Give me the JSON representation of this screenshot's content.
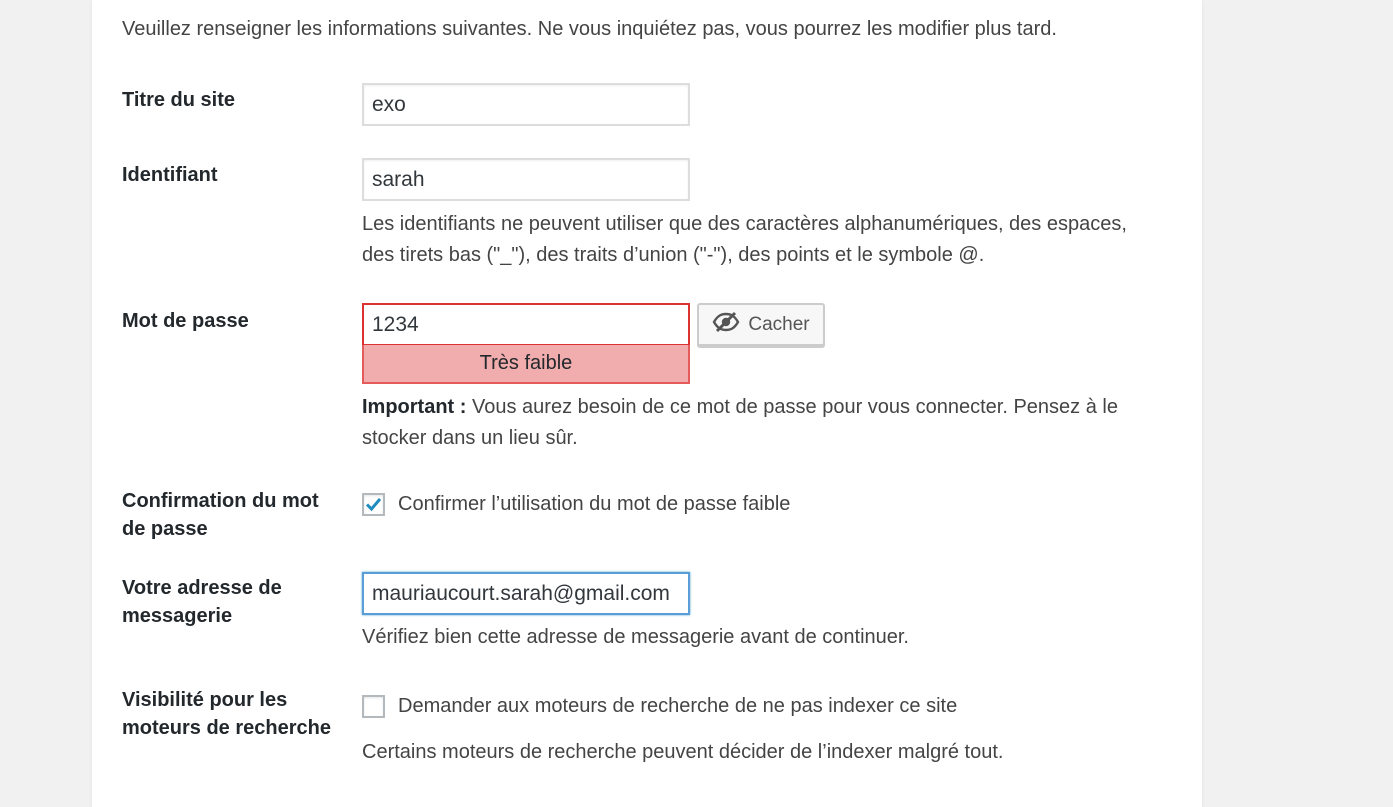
{
  "intro_text": "Veuillez renseigner les informations suivantes. Ne vous inquiétez pas, vous pourrez les modifier plus tard.",
  "site_title": {
    "label": "Titre du site",
    "value": "exo"
  },
  "username": {
    "label": "Identifiant",
    "value": "sarah",
    "help": "Les identifiants ne peuvent utiliser que des caractères alphanumériques, des espaces, des tirets bas (\"_\"), des traits d’union (\"-\"), des points et le symbole @."
  },
  "password": {
    "label": "Mot de passe",
    "value": "1234",
    "strength": "Très faible",
    "toggle_label": "Cacher",
    "toggle_icon": "eye-slash-icon",
    "important_prefix": "Important :",
    "important_text": " Vous aurez besoin de ce mot de passe pour vous connecter. Pensez à le stocker dans un lieu sûr.",
    "strength_color": "#f1adad",
    "border_color": "#dc3232"
  },
  "weak_confirm": {
    "label": "Confirmation du mot de passe",
    "checkbox_label": "Confirmer l’utilisation du mot de passe faible",
    "checked": true
  },
  "email": {
    "label": "Votre adresse de messagerie",
    "value": "mauriaucourt.sarah@gmail.com",
    "help": "Vérifiez bien cette adresse de messagerie avant de continuer."
  },
  "search_visibility": {
    "label": "Visibilité pour les moteurs de recherche",
    "checkbox_label": "Demander aux moteurs de recherche de ne pas indexer ce site",
    "checked": false,
    "help": "Certains moteurs de recherche peuvent décider de l’indexer malgré tout."
  },
  "colors": {
    "accent": "#1e8cbe",
    "focus_border": "#5b9dd9"
  }
}
